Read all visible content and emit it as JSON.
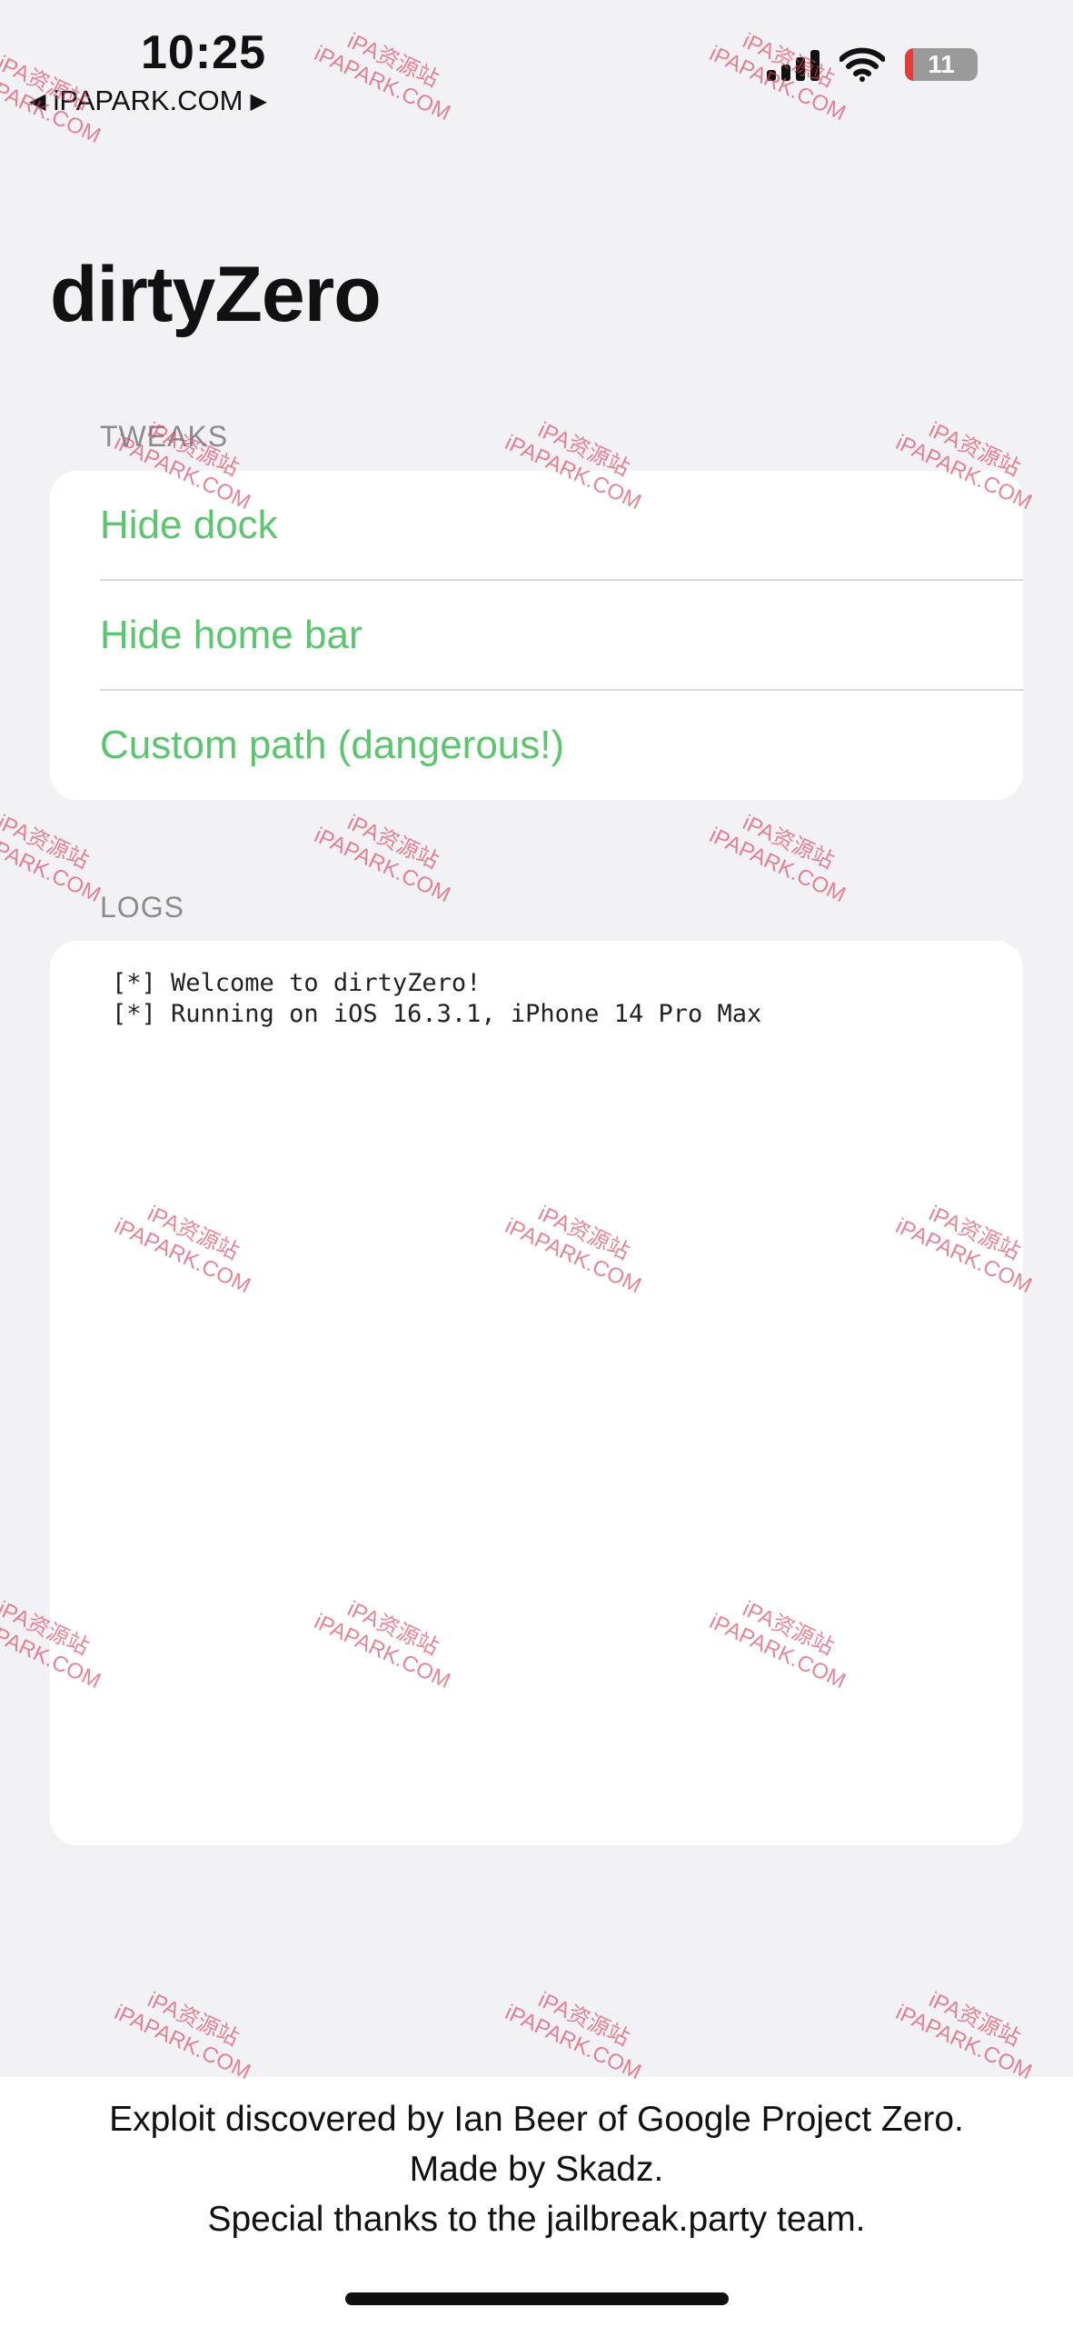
{
  "status_bar": {
    "time": "10:25",
    "back_link": "iPAPARK.COM",
    "battery_level": "11"
  },
  "app": {
    "title": "dirtyZero"
  },
  "tweaks": {
    "header": "TWEAKS",
    "items": [
      {
        "label": "Hide dock"
      },
      {
        "label": "Hide home bar"
      },
      {
        "label": "Custom path (dangerous!)"
      }
    ],
    "accent_color": "#5dc46f"
  },
  "logs": {
    "header": "LOGS",
    "lines": [
      "[*] Welcome to dirtyZero!",
      "[*] Running on iOS 16.3.1, iPhone 14 Pro Max"
    ]
  },
  "footer": {
    "line1": "Exploit discovered by Ian Beer of Google Project Zero.",
    "line2": "Made by Skadz.",
    "line3": "Special thanks to the jailbreak.party team."
  },
  "watermark": {
    "line1": "iPA资源站",
    "line2": "iPAPARK.COM"
  }
}
